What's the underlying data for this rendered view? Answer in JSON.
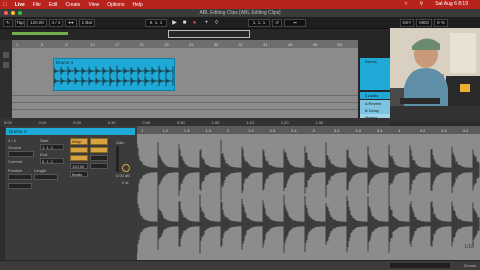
{
  "menubar": {
    "items": [
      "Live",
      "File",
      "Edit",
      "Create",
      "View",
      "Options",
      "Help"
    ],
    "clock": "Sat Aug 6 8:19"
  },
  "window": {
    "title": "ABL Editing Clips [ABL Editing Clips]"
  },
  "transport": {
    "tap_label": "Tap",
    "tempo": "120.00",
    "signature": "4 / 4",
    "quantize": "1 Bar",
    "position": "5. 1. 1",
    "loop_start": "1. 1. 1",
    "key_label": "KEY",
    "midi_label": "MIDI",
    "cpu": "8 %"
  },
  "arrangement": {
    "ruler_marks": [
      "1",
      "5",
      "9",
      "13",
      "17",
      "21",
      "25",
      "29",
      "33",
      "37",
      "41",
      "45",
      "49",
      "53"
    ],
    "time_marks": [
      "0:00",
      "0:10",
      "0:20",
      "0:30",
      "0:40",
      "0:50",
      "1:00",
      "1:10",
      "1:20",
      "1:30"
    ],
    "clip": {
      "name": "Drums 4"
    },
    "tracks": [
      "Drums",
      "3 Audio",
      "A Reverb",
      "B Delay",
      "Master"
    ]
  },
  "clip_view": {
    "header": "Drums 4",
    "signature": "4 / 4",
    "groove_label": "Groove",
    "commit_label": "Commit",
    "position_label": "Position",
    "length_label": "Length",
    "start_value": "1. 1. 1",
    "end_value": "5. 1. 1",
    "warp_label": "Warp",
    "seg_bpm": "120.00",
    "mode": "Beats",
    "gain": "0.00 dB",
    "pitch": "0 st"
  },
  "editor": {
    "ruler_marks": [
      "1",
      "1.2",
      "1.3",
      "1.4",
      "2",
      "2.2",
      "2.3",
      "2.4",
      "3",
      "3.2",
      "3.3",
      "3.4",
      "4",
      "4.2",
      "4.3",
      "4.4"
    ],
    "page_indicator": "1/16"
  },
  "status": {
    "track_label": "Drums"
  },
  "colors": {
    "accent": "#1fa9d6",
    "menubar": "#b8231e",
    "clip_orange": "#d7a441"
  }
}
